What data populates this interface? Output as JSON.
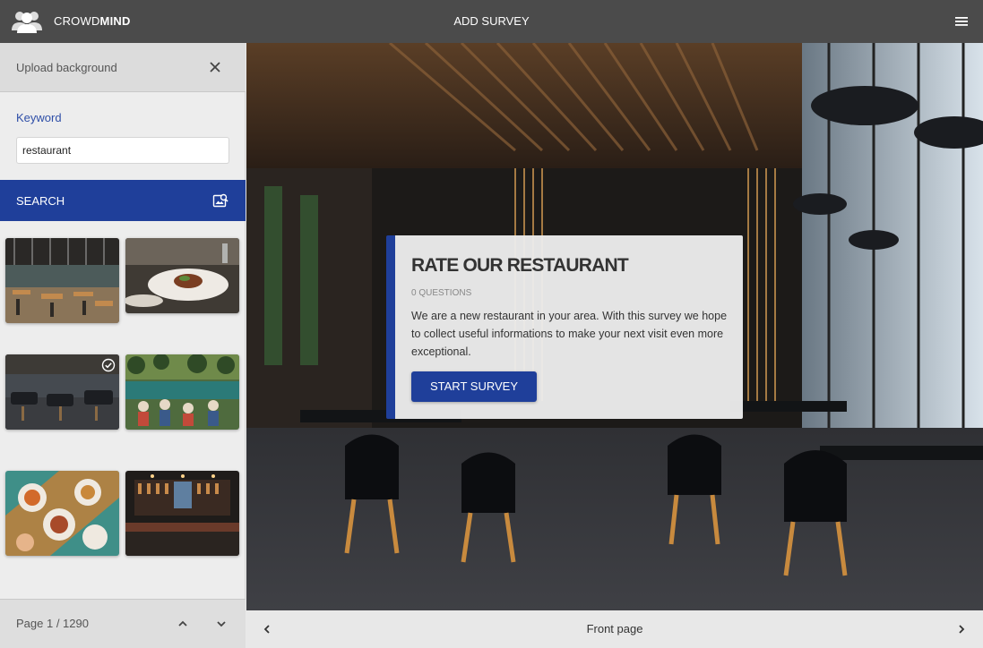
{
  "header": {
    "brand_part1": "CROWD",
    "brand_part2": "MIND",
    "title": "ADD SURVEY",
    "logo_icon": "users-group-icon",
    "menu_icon": "hamburger-menu-icon"
  },
  "sidebar": {
    "upload_label": "Upload background",
    "keyword_label": "Keyword",
    "keyword_value": "restaurant",
    "search_label": "SEARCH",
    "search_icon": "image-search-icon",
    "thumbnails": [
      {
        "name": "restaurant-interior-industrial",
        "selected": false
      },
      {
        "name": "plated-dish-table",
        "selected": false
      },
      {
        "name": "dark-dining-room",
        "selected": true
      },
      {
        "name": "garden-terrace-diners",
        "selected": false
      },
      {
        "name": "overhead-food-sharing",
        "selected": false
      },
      {
        "name": "bar-counter-night",
        "selected": false
      }
    ],
    "pager_label": "Page 1 / 1290"
  },
  "survey": {
    "title": "RATE OUR RESTAURANT",
    "questions": "0 QUESTIONS",
    "description": "We are a new restaurant in your area. With this survey we hope to collect useful informations to make your next visit even more exceptional.",
    "start_label": "START SURVEY"
  },
  "footer": {
    "label": "Front page"
  },
  "colors": {
    "accent": "#1f3f9a",
    "topbar": "#4b4b4b"
  }
}
